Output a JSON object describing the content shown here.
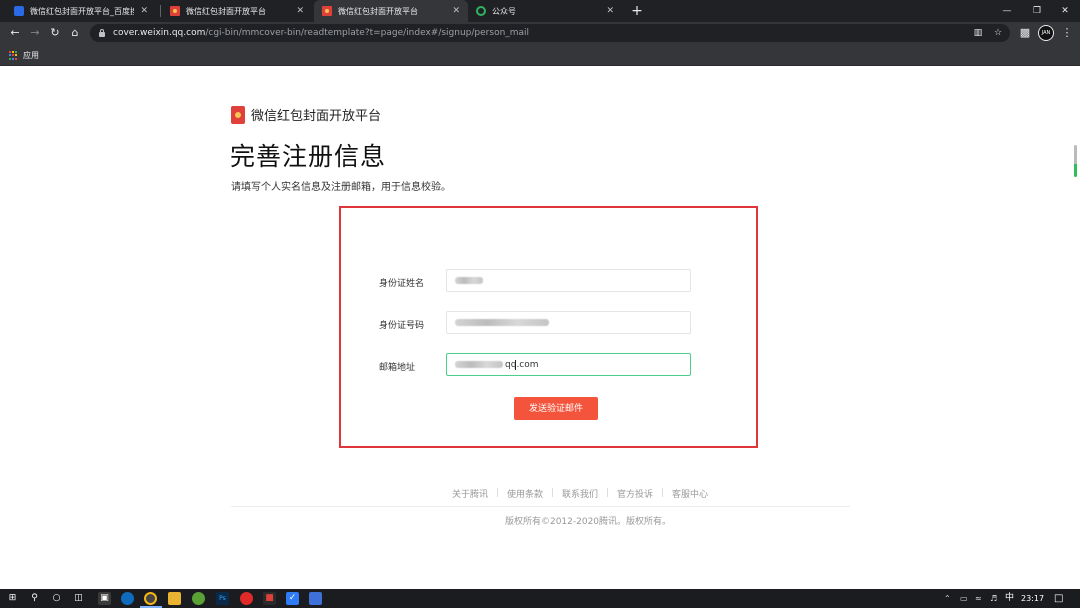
{
  "browser": {
    "tabs": [
      {
        "title": "微信红包封面开放平台_百度搜索",
        "active": false,
        "favicon": "baidu-paw-icon"
      },
      {
        "title": "微信红包封面开放平台",
        "active": false,
        "favicon": "red-envelope-icon"
      },
      {
        "title": "微信红包封面开放平台",
        "active": true,
        "favicon": "red-envelope-icon"
      },
      {
        "title": "公众号",
        "active": false,
        "favicon": "official-account-icon"
      }
    ],
    "close_glyph": "✕",
    "new_tab_glyph": "+",
    "window_controls": {
      "minimize": "—",
      "restore": "❐",
      "close": "✕"
    },
    "url_host": "cover.weixin.qq.com",
    "url_path": "/cgi-bin/mmcover-bin/readtemplate?t=page/index#/signup/person_mail",
    "avatar_text": "JAN",
    "bookmarks": [
      {
        "label": "应用",
        "icon": "apps-grid-icon"
      }
    ]
  },
  "page": {
    "brand_name": "微信红包封面开放平台",
    "title": "完善注册信息",
    "subtitle": "请填写个人实名信息及注册邮箱，用于信息校验。",
    "form": {
      "fields": [
        {
          "label": "身份证姓名",
          "value": "",
          "redacted": true
        },
        {
          "label": "身份证号码",
          "value": "",
          "redacted": true
        },
        {
          "label": "邮箱地址",
          "value_suffix_before_caret": "qq",
          "value_suffix_after_caret": ".com",
          "redacted": true,
          "focused": true
        }
      ],
      "submit_label": "发送验证邮件",
      "highlight_color": "#e0353a",
      "button_color": "#f4533c",
      "focus_color": "#4ccf8d"
    },
    "footer": {
      "links": [
        "关于腾讯",
        "使用条款",
        "联系我们",
        "官方投诉",
        "客服中心"
      ],
      "copyright": "版权所有©2012-2020腾讯。版权所有。"
    }
  },
  "taskbar": {
    "ime": "中",
    "time": "23:17"
  }
}
